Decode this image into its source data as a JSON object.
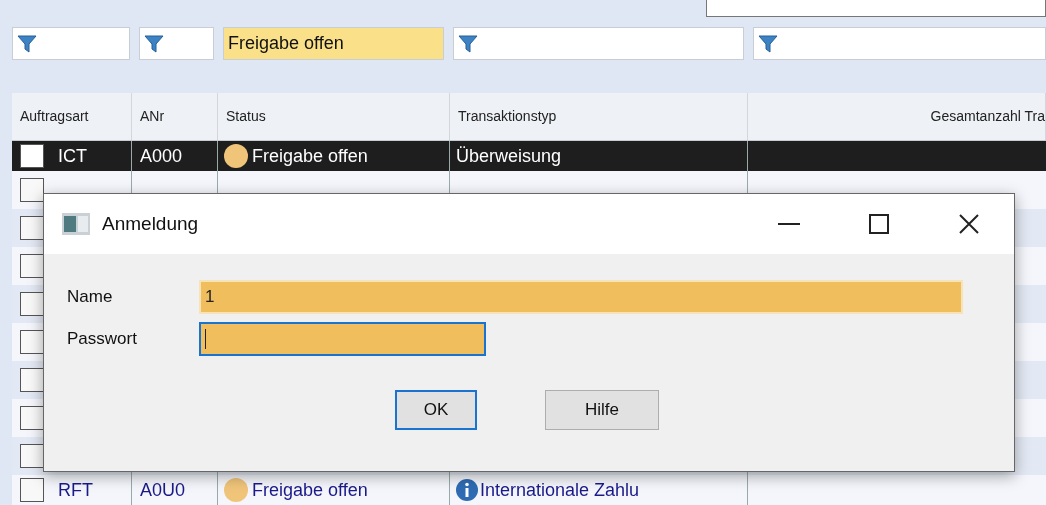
{
  "filters": [
    {
      "filled": false
    },
    {
      "filled": false
    },
    {
      "filled": true,
      "value": "Freigabe offen"
    },
    {
      "filled": false
    },
    {
      "filled": false
    }
  ],
  "columns": [
    "Auftragsart",
    "ANr",
    "Status",
    "Transaktionstyp",
    "Gesamtanzahl Tra"
  ],
  "rows": [
    {
      "selected": true,
      "checked": false,
      "type": "ICT",
      "number": "A000",
      "status": "Freigabe offen",
      "transaction": "Überweisung",
      "info": false
    },
    {
      "selected": false,
      "checked": false
    },
    {
      "selected": false,
      "checked": false
    },
    {
      "selected": false,
      "checked": false
    },
    {
      "selected": false,
      "checked": false
    },
    {
      "selected": false,
      "checked": false
    },
    {
      "selected": false,
      "checked": false
    },
    {
      "selected": false,
      "checked": false
    },
    {
      "selected": false,
      "checked": false
    },
    {
      "selected": false,
      "checked": false,
      "type": "RFT",
      "number": "A0U0",
      "status": "Freigabe offen",
      "transaction": "Internationale Zahlu",
      "info": true
    }
  ],
  "dialog": {
    "title": "Anmeldung",
    "fields": [
      {
        "label": "Name",
        "value": "1",
        "focused": false
      },
      {
        "label": "Passwort",
        "focused": true
      }
    ],
    "buttons": [
      {
        "label": "OK",
        "default": true
      },
      {
        "label": "Hilfe",
        "default": false
      }
    ]
  }
}
